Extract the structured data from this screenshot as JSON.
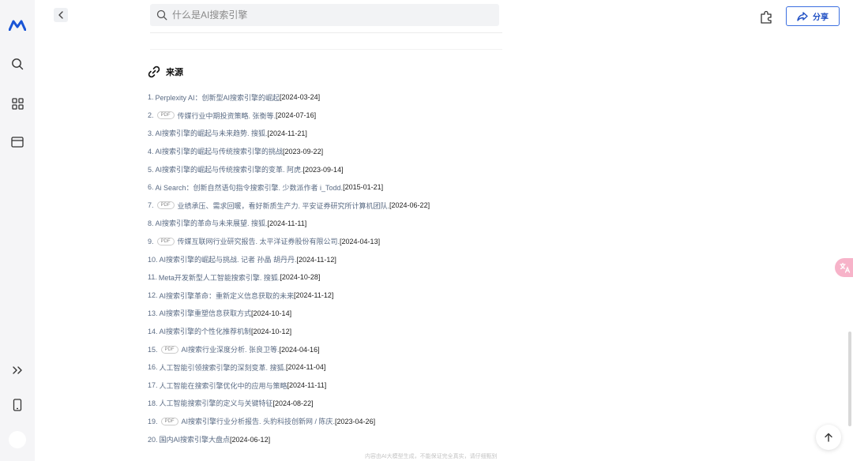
{
  "search": {
    "placeholder": "什么是AI搜索引擎"
  },
  "header": {
    "share_label": "分享"
  },
  "sources": {
    "title": "来源",
    "pdf_badge": "PDF",
    "items": [
      {
        "num": "1.",
        "pdf": false,
        "text": "Perplexity AI：创新型AI搜索引擎的崛起",
        "date": "[2024-03-24]"
      },
      {
        "num": "2.",
        "pdf": true,
        "text": "传媒行业中期投资策略. 张衡等.",
        "date": "[2024-07-16]"
      },
      {
        "num": "3.",
        "pdf": false,
        "text": "AI搜索引擎的崛起与未来趋势. 搜狐.",
        "date": "[2024-11-21]"
      },
      {
        "num": "4.",
        "pdf": false,
        "text": "AI搜索引擎的崛起与传统搜索引擎的挑战",
        "date": "[2023-09-22]"
      },
      {
        "num": "5.",
        "pdf": false,
        "text": "AI搜索引擎的崛起与传统搜索引擎的变革. 阿虎.",
        "date": "[2023-09-14]"
      },
      {
        "num": "6.",
        "pdf": false,
        "text": "Ai Search：创新自然语句指令搜索引擎. 少数派作者 i_Todd.",
        "date": "[2015-01-21]"
      },
      {
        "num": "7.",
        "pdf": true,
        "text": "业绩承压、需求回暖，看好新质生产力. 平安证券研究所计算机团队.",
        "date": "[2024-06-22]"
      },
      {
        "num": "8.",
        "pdf": false,
        "text": "AI搜索引擎的革命与未来展望. 搜狐.",
        "date": "[2024-11-11]"
      },
      {
        "num": "9.",
        "pdf": true,
        "text": "传媒互联网行业研究报告. 太平洋证券股份有限公司.",
        "date": "[2024-04-13]"
      },
      {
        "num": "10.",
        "pdf": false,
        "text": "AI搜索引擎的崛起与挑战. 记者 孙晶 胡丹丹.",
        "date": "[2024-11-12]"
      },
      {
        "num": "11.",
        "pdf": false,
        "text": "Meta开发新型人工智能搜索引擎. 搜狐.",
        "date": "[2024-10-28]"
      },
      {
        "num": "12.",
        "pdf": false,
        "text": "AI搜索引擎革命：重新定义信息获取的未来",
        "date": "[2024-11-12]"
      },
      {
        "num": "13.",
        "pdf": false,
        "text": "AI搜索引擎重塑信息获取方式",
        "date": "[2024-10-14]"
      },
      {
        "num": "14.",
        "pdf": false,
        "text": "AI搜索引擎的个性化推荐机制",
        "date": "[2024-10-12]"
      },
      {
        "num": "15.",
        "pdf": true,
        "text": "AI搜索行业深度分析. 张良卫等.",
        "date": "[2024-04-16]"
      },
      {
        "num": "16.",
        "pdf": false,
        "text": "人工智能引领搜索引擎的深刻变革. 搜狐.",
        "date": "[2024-11-04]"
      },
      {
        "num": "17.",
        "pdf": false,
        "text": "人工智能在搜索引擎优化中的应用与策略",
        "date": "[2024-11-11]"
      },
      {
        "num": "18.",
        "pdf": false,
        "text": "人工智能搜索引擎的定义与关键特征",
        "date": "[2024-08-22]"
      },
      {
        "num": "19.",
        "pdf": true,
        "text": "AI搜索引擎行业分析报告. 头豹科技创新网 / 陈庆.",
        "date": "[2023-04-26]"
      },
      {
        "num": "20.",
        "pdf": false,
        "text": "国内AI搜索引擎大盘点",
        "date": "[2024-06-12]"
      }
    ]
  },
  "footer": {
    "note": "内容由AI大模型生成，不能保证完全真实，请仔细甄别"
  },
  "colors": {
    "accent": "#1f4fc4",
    "link": "#5a6b84",
    "brand": "#1a55d6"
  },
  "icons": {
    "logo": "brand-logo-icon",
    "search": "search-icon",
    "apps": "apps-grid-icon",
    "window": "window-icon",
    "expand": "double-chevron-right-icon",
    "mobile": "mobile-icon",
    "back": "chevron-left-icon",
    "plugin": "puzzle-icon",
    "share": "share-arrow-icon",
    "link": "link-icon",
    "translate": "translate-icon",
    "scroll_top": "arrow-up-icon"
  }
}
